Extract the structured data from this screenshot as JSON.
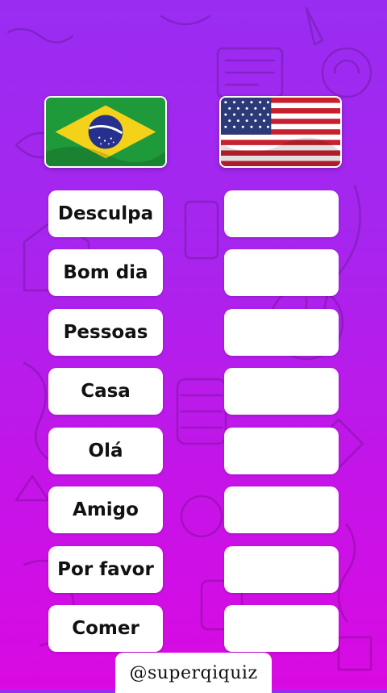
{
  "flags": {
    "source": {
      "icon": "brazil-flag-icon"
    },
    "target": {
      "icon": "usa-flag-icon"
    }
  },
  "words": [
    {
      "label": "Desculpa"
    },
    {
      "label": "Bom dia"
    },
    {
      "label": "Pessoas"
    },
    {
      "label": "Casa"
    },
    {
      "label": "Olá"
    },
    {
      "label": "Amigo"
    },
    {
      "label": "Por favor"
    },
    {
      "label": "Comer"
    }
  ],
  "answers": [
    "",
    "",
    "",
    "",
    "",
    "",
    "",
    ""
  ],
  "footer": {
    "handle": "@superqiquiz"
  },
  "colors": {
    "background_top": "#9a2cf2",
    "background_bottom": "#d90ae2",
    "card": "#ffffff",
    "text": "#111111"
  }
}
